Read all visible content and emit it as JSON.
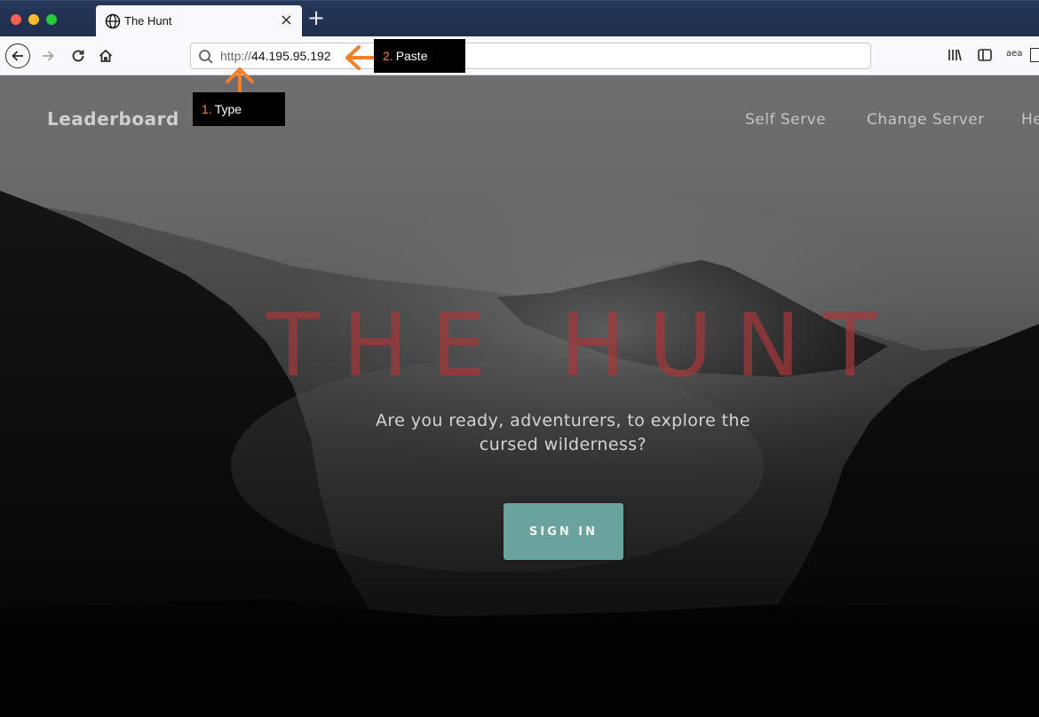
{
  "browser": {
    "tab_title": "The Hunt",
    "tab_close": "×",
    "new_tab": "+",
    "url_scheme": "http://",
    "url_host": "44.195.95.192",
    "toolbar_right": [
      "library-icon",
      "sidebar-icon",
      "amazon-assistant-icon"
    ],
    "amazon_label": "aea"
  },
  "site": {
    "logo": "Leaderboard",
    "nav_links": [
      "Self Serve",
      "Change Server",
      "He"
    ],
    "hero_title": "THE HUNT",
    "hero_subtitle_line1": "Are you ready, adventurers, to explore the",
    "hero_subtitle_line2": "cursed wilderness?",
    "sign_in": "SIGN IN"
  },
  "annotations": {
    "step1_num": "1.",
    "step1_text": "Type",
    "step2_num": "2.",
    "step2_text": "Paste",
    "accent_color": "#f2802e"
  },
  "colors": {
    "hero_title": "#a4383a",
    "button": "#6aa29e"
  }
}
